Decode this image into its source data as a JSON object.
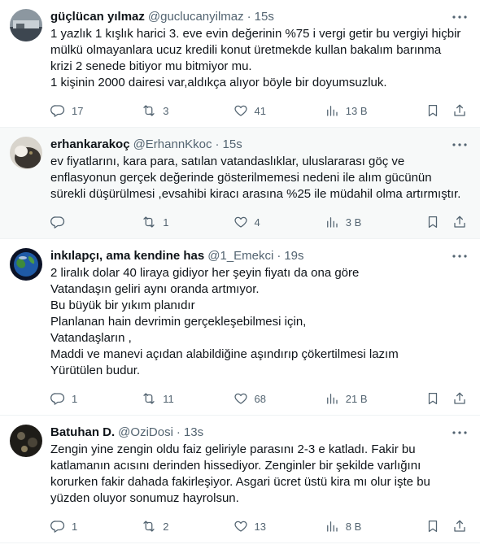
{
  "tweets": [
    {
      "name": "güçlücan yılmaz",
      "handle": "@guclucanyilmaz",
      "time": "15s",
      "text": "1 yazlık 1 kışlık harici 3. eve evin değerinin %75 i vergi getir bu vergiyi hiçbir\nmülkü olmayanlara ucuz kredili konut üretmekde kullan bakalım barınma\nkrizi 2 senede bitiyor mu bitmiyor mu.\n1 kişinin 2000 dairesi var,aldıkça alıyor böyle bir doyumsuzluk.",
      "replies": "17",
      "reposts": "3",
      "likes": "41",
      "views": "13 B",
      "highlighted": false,
      "avatar_color": "#4a5560"
    },
    {
      "name": "erhankarakoç",
      "handle": "@ErhannKkoc",
      "time": "15s",
      "text": "ev fiyatlarını, kara para, satılan vatandaslıklar, uluslararası göç ve\nenflasyonun gerçek değerinde gösterilmemesi nedeni ile alım gücünün\nsürekli düşürülmesi ,evsahibi kiracı arasına %25 ile müdahil olma artırmıştır.",
      "replies": "",
      "reposts": "1",
      "likes": "4",
      "views": "3 B",
      "highlighted": true,
      "avatar_color": "#6b5e4e"
    },
    {
      "name": "inkılapçı, ama kendine has",
      "handle": "@1_Emekci",
      "time": "19s",
      "text": "2 liralık dolar 40 liraya gidiyor her şeyin fiyatı da ona göre\nVatandaşın geliri aynı oranda artmıyor.\nBu büyük bir yıkım planıdır\nPlanlanan hain devrimin gerçekleşebilmesi için,\nVatandaşların ,\nMaddi ve manevi açıdan alabildiğine aşındırıp çökertilmesi lazım\nYürütülen budur.",
      "replies": "1",
      "reposts": "11",
      "likes": "68",
      "views": "21 B",
      "highlighted": false,
      "avatar_color": "#1f3f6e"
    },
    {
      "name": "Batuhan D.",
      "handle": "@OziDosi",
      "time": "13s",
      "text": "Zengin yine zengin oldu faiz geliriyle parasını 2-3 e katladı. Fakir bu\nkatlamanın acısını derinden hissediyor. Zenginler bir şekilde varlığını\nkorurken fakir dahada fakirleşiyor. Asgari ücret üstü kira mı olur işte bu\nyüzden oluyor sonumuz hayrolsun.",
      "replies": "1",
      "reposts": "2",
      "likes": "13",
      "views": "8 B",
      "highlighted": false,
      "avatar_color": "#2e2a24"
    }
  ],
  "meta": {
    "dot": "·"
  },
  "icons": {
    "reply": "reply-icon",
    "repost": "repost-icon",
    "like": "like-icon",
    "views": "views-icon",
    "bookmark": "bookmark-icon",
    "share": "share-icon",
    "more": "more-icon"
  }
}
